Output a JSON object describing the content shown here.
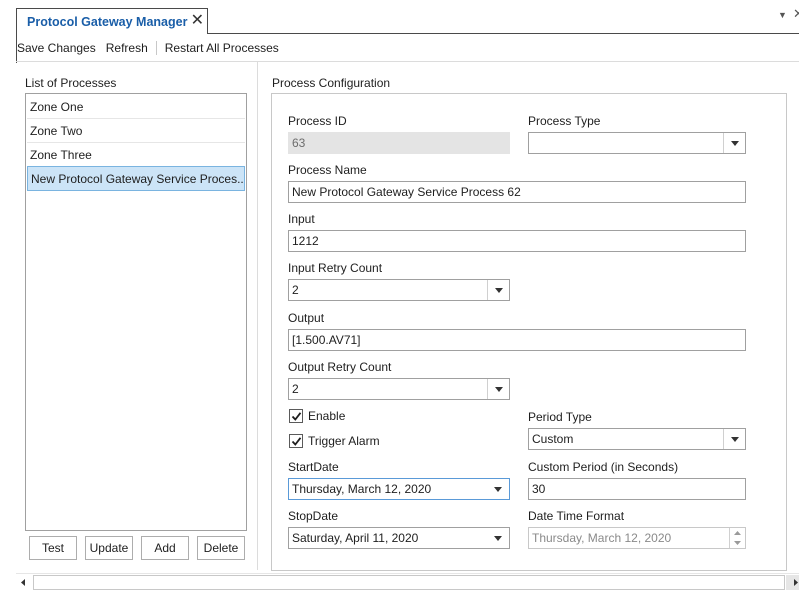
{
  "tab": {
    "title": "Protocol Gateway Manager",
    "close_glyph": "✕"
  },
  "window_controls": {
    "dropdown_glyph": "▼",
    "close_glyph": "✕"
  },
  "toolbar": {
    "save_label": "Save Changes",
    "refresh_label": "Refresh",
    "restart_label": "Restart All Processes"
  },
  "left_panel": {
    "title": "List of Processes",
    "processes": [
      {
        "label": "Zone One",
        "selected": false
      },
      {
        "label": "Zone Two",
        "selected": false
      },
      {
        "label": "Zone Three",
        "selected": false
      },
      {
        "label": "New Protocol Gateway Service Proces...",
        "selected": true
      }
    ],
    "buttons": {
      "test": "Test",
      "update": "Update",
      "add": "Add",
      "delete": "Delete"
    }
  },
  "config": {
    "title": "Process Configuration",
    "process_id": {
      "label": "Process ID",
      "value": "63"
    },
    "process_type": {
      "label": "Process Type",
      "value": ""
    },
    "process_name": {
      "label": "Process Name",
      "value": "New Protocol Gateway Service Process 62"
    },
    "input": {
      "label": "Input",
      "value": "1212"
    },
    "input_retry_count": {
      "label": "Input Retry Count",
      "value": "2"
    },
    "output": {
      "label": "Output",
      "value": "[1.500.AV71]"
    },
    "output_retry_count": {
      "label": "Output Retry Count",
      "value": "2"
    },
    "enable": {
      "label": "Enable",
      "checked": true
    },
    "trigger_alarm": {
      "label": "Trigger Alarm",
      "checked": true
    },
    "period_type": {
      "label": "Period Type",
      "value": "Custom"
    },
    "start_date": {
      "label": "StartDate",
      "value": "Thursday, March 12, 2020"
    },
    "custom_period": {
      "label": "Custom Period (in Seconds)",
      "value": "30"
    },
    "stop_date": {
      "label": "StopDate",
      "value": "Saturday, April 11, 2020"
    },
    "date_time_format": {
      "label": "Date Time Format",
      "value": "Thursday, March 12, 2020"
    }
  },
  "colors": {
    "accent": "#1a5ea8",
    "selection_bg": "#cce4f7",
    "selection_border": "#7ab4e0",
    "readonly_bg": "#e4e4e4"
  }
}
